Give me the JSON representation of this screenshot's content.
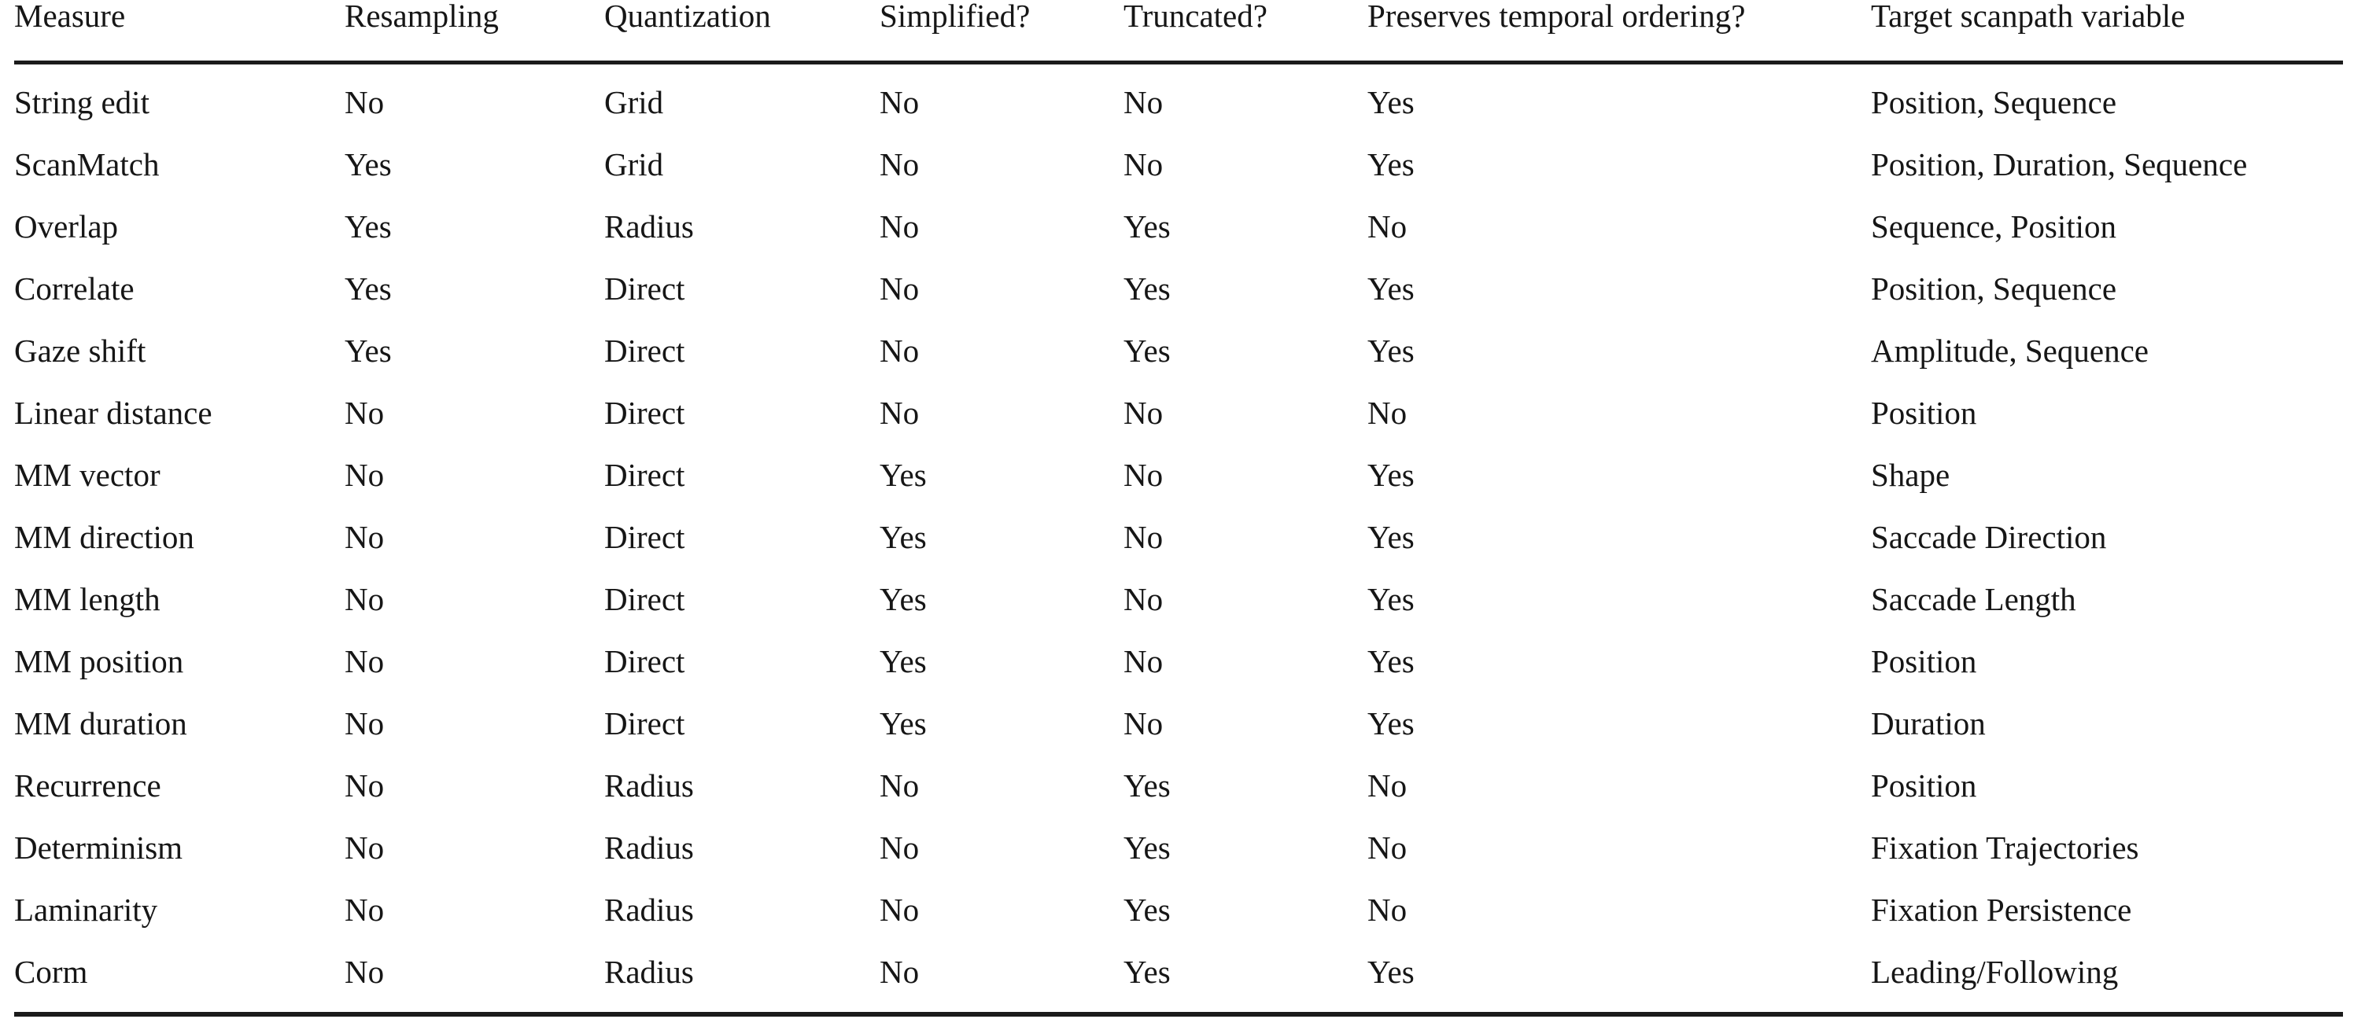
{
  "table": {
    "columns": [
      "Measure",
      "Resampling",
      "Quantization",
      "Simplified?",
      "Truncated?",
      "Preserves temporal ordering?",
      "Target scanpath variable"
    ],
    "rows": [
      {
        "measure": "String edit",
        "resampling": "No",
        "quantization": "Grid",
        "simplified": "No",
        "truncated": "No",
        "preserves_temporal_ordering": "Yes",
        "target_scanpath_variable": "Position, Sequence"
      },
      {
        "measure": "ScanMatch",
        "resampling": "Yes",
        "quantization": "Grid",
        "simplified": "No",
        "truncated": "No",
        "preserves_temporal_ordering": "Yes",
        "target_scanpath_variable": "Position, Duration, Sequence"
      },
      {
        "measure": "Overlap",
        "resampling": "Yes",
        "quantization": "Radius",
        "simplified": "No",
        "truncated": "Yes",
        "preserves_temporal_ordering": "No",
        "target_scanpath_variable": "Sequence, Position"
      },
      {
        "measure": "Correlate",
        "resampling": "Yes",
        "quantization": "Direct",
        "simplified": "No",
        "truncated": "Yes",
        "preserves_temporal_ordering": "Yes",
        "target_scanpath_variable": "Position, Sequence"
      },
      {
        "measure": "Gaze shift",
        "resampling": "Yes",
        "quantization": "Direct",
        "simplified": "No",
        "truncated": "Yes",
        "preserves_temporal_ordering": "Yes",
        "target_scanpath_variable": "Amplitude, Sequence"
      },
      {
        "measure": "Linear distance",
        "resampling": "No",
        "quantization": "Direct",
        "simplified": "No",
        "truncated": "No",
        "preserves_temporal_ordering": "No",
        "target_scanpath_variable": "Position"
      },
      {
        "measure": "MM vector",
        "resampling": "No",
        "quantization": "Direct",
        "simplified": "Yes",
        "truncated": "No",
        "preserves_temporal_ordering": "Yes",
        "target_scanpath_variable": "Shape"
      },
      {
        "measure": "MM direction",
        "resampling": "No",
        "quantization": "Direct",
        "simplified": "Yes",
        "truncated": "No",
        "preserves_temporal_ordering": "Yes",
        "target_scanpath_variable": "Saccade Direction"
      },
      {
        "measure": "MM length",
        "resampling": "No",
        "quantization": "Direct",
        "simplified": "Yes",
        "truncated": "No",
        "preserves_temporal_ordering": "Yes",
        "target_scanpath_variable": "Saccade Length"
      },
      {
        "measure": "MM position",
        "resampling": "No",
        "quantization": "Direct",
        "simplified": "Yes",
        "truncated": "No",
        "preserves_temporal_ordering": "Yes",
        "target_scanpath_variable": "Position"
      },
      {
        "measure": "MM duration",
        "resampling": "No",
        "quantization": "Direct",
        "simplified": "Yes",
        "truncated": "No",
        "preserves_temporal_ordering": "Yes",
        "target_scanpath_variable": "Duration"
      },
      {
        "measure": "Recurrence",
        "resampling": "No",
        "quantization": "Radius",
        "simplified": "No",
        "truncated": "Yes",
        "preserves_temporal_ordering": "No",
        "target_scanpath_variable": "Position"
      },
      {
        "measure": "Determinism",
        "resampling": "No",
        "quantization": "Radius",
        "simplified": "No",
        "truncated": "Yes",
        "preserves_temporal_ordering": "No",
        "target_scanpath_variable": "Fixation Trajectories"
      },
      {
        "measure": "Laminarity",
        "resampling": "No",
        "quantization": "Radius",
        "simplified": "No",
        "truncated": "Yes",
        "preserves_temporal_ordering": "No",
        "target_scanpath_variable": "Fixation Persistence"
      },
      {
        "measure": "Corm",
        "resampling": "No",
        "quantization": "Radius",
        "simplified": "No",
        "truncated": "Yes",
        "preserves_temporal_ordering": "Yes",
        "target_scanpath_variable": "Leading/Following"
      }
    ]
  },
  "style": {
    "rule_color": "#1b1b1b",
    "text_color": "#161616",
    "background": "#ffffff"
  }
}
